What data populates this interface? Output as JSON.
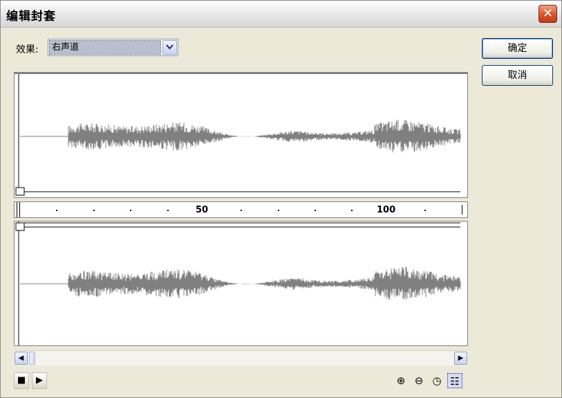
{
  "window": {
    "title": "编辑封套",
    "close_label": "✕"
  },
  "effect": {
    "label": "效果:",
    "selected": "右声道"
  },
  "buttons": {
    "ok": "确定",
    "cancel": "取消"
  },
  "ruler": {
    "labels": [
      "50",
      "100"
    ]
  },
  "scrollbar": {
    "left_arrow": "◀",
    "right_arrow": "▶"
  },
  "playback": {
    "stop": "■",
    "play": "▶"
  },
  "tools": {
    "zoom_in": "⊕",
    "zoom_out": "⊖",
    "time": "◷",
    "frames": "☷"
  },
  "colors": {
    "waveform": "#808080",
    "window_bg": "#ece9d8",
    "accent": "#1c2fb0"
  }
}
